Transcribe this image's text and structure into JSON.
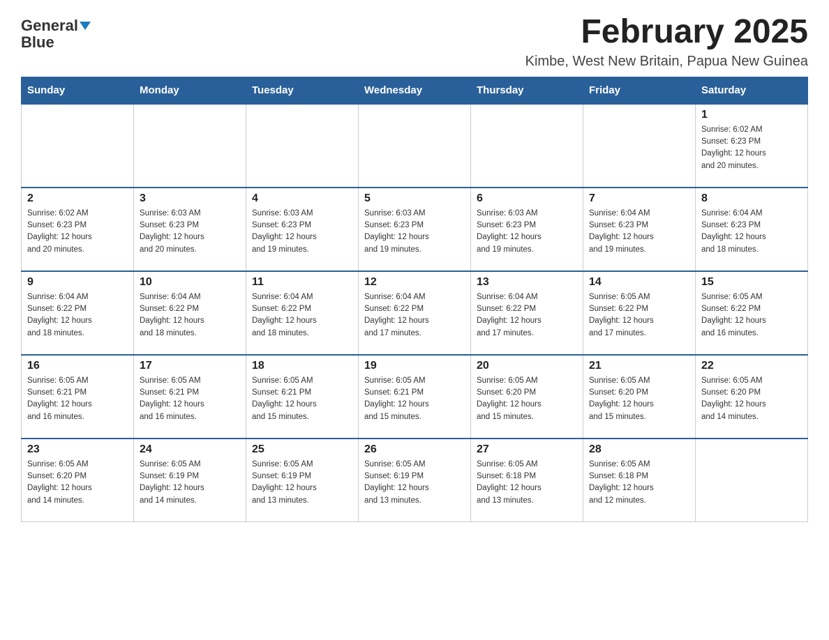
{
  "header": {
    "logo_line1": "General",
    "logo_line2": "Blue",
    "month_title": "February 2025",
    "location": "Kimbe, West New Britain, Papua New Guinea"
  },
  "weekdays": [
    "Sunday",
    "Monday",
    "Tuesday",
    "Wednesday",
    "Thursday",
    "Friday",
    "Saturday"
  ],
  "weeks": [
    [
      {
        "day": "",
        "info": ""
      },
      {
        "day": "",
        "info": ""
      },
      {
        "day": "",
        "info": ""
      },
      {
        "day": "",
        "info": ""
      },
      {
        "day": "",
        "info": ""
      },
      {
        "day": "",
        "info": ""
      },
      {
        "day": "1",
        "info": "Sunrise: 6:02 AM\nSunset: 6:23 PM\nDaylight: 12 hours\nand 20 minutes."
      }
    ],
    [
      {
        "day": "2",
        "info": "Sunrise: 6:02 AM\nSunset: 6:23 PM\nDaylight: 12 hours\nand 20 minutes."
      },
      {
        "day": "3",
        "info": "Sunrise: 6:03 AM\nSunset: 6:23 PM\nDaylight: 12 hours\nand 20 minutes."
      },
      {
        "day": "4",
        "info": "Sunrise: 6:03 AM\nSunset: 6:23 PM\nDaylight: 12 hours\nand 19 minutes."
      },
      {
        "day": "5",
        "info": "Sunrise: 6:03 AM\nSunset: 6:23 PM\nDaylight: 12 hours\nand 19 minutes."
      },
      {
        "day": "6",
        "info": "Sunrise: 6:03 AM\nSunset: 6:23 PM\nDaylight: 12 hours\nand 19 minutes."
      },
      {
        "day": "7",
        "info": "Sunrise: 6:04 AM\nSunset: 6:23 PM\nDaylight: 12 hours\nand 19 minutes."
      },
      {
        "day": "8",
        "info": "Sunrise: 6:04 AM\nSunset: 6:23 PM\nDaylight: 12 hours\nand 18 minutes."
      }
    ],
    [
      {
        "day": "9",
        "info": "Sunrise: 6:04 AM\nSunset: 6:22 PM\nDaylight: 12 hours\nand 18 minutes."
      },
      {
        "day": "10",
        "info": "Sunrise: 6:04 AM\nSunset: 6:22 PM\nDaylight: 12 hours\nand 18 minutes."
      },
      {
        "day": "11",
        "info": "Sunrise: 6:04 AM\nSunset: 6:22 PM\nDaylight: 12 hours\nand 18 minutes."
      },
      {
        "day": "12",
        "info": "Sunrise: 6:04 AM\nSunset: 6:22 PM\nDaylight: 12 hours\nand 17 minutes."
      },
      {
        "day": "13",
        "info": "Sunrise: 6:04 AM\nSunset: 6:22 PM\nDaylight: 12 hours\nand 17 minutes."
      },
      {
        "day": "14",
        "info": "Sunrise: 6:05 AM\nSunset: 6:22 PM\nDaylight: 12 hours\nand 17 minutes."
      },
      {
        "day": "15",
        "info": "Sunrise: 6:05 AM\nSunset: 6:22 PM\nDaylight: 12 hours\nand 16 minutes."
      }
    ],
    [
      {
        "day": "16",
        "info": "Sunrise: 6:05 AM\nSunset: 6:21 PM\nDaylight: 12 hours\nand 16 minutes."
      },
      {
        "day": "17",
        "info": "Sunrise: 6:05 AM\nSunset: 6:21 PM\nDaylight: 12 hours\nand 16 minutes."
      },
      {
        "day": "18",
        "info": "Sunrise: 6:05 AM\nSunset: 6:21 PM\nDaylight: 12 hours\nand 15 minutes."
      },
      {
        "day": "19",
        "info": "Sunrise: 6:05 AM\nSunset: 6:21 PM\nDaylight: 12 hours\nand 15 minutes."
      },
      {
        "day": "20",
        "info": "Sunrise: 6:05 AM\nSunset: 6:20 PM\nDaylight: 12 hours\nand 15 minutes."
      },
      {
        "day": "21",
        "info": "Sunrise: 6:05 AM\nSunset: 6:20 PM\nDaylight: 12 hours\nand 15 minutes."
      },
      {
        "day": "22",
        "info": "Sunrise: 6:05 AM\nSunset: 6:20 PM\nDaylight: 12 hours\nand 14 minutes."
      }
    ],
    [
      {
        "day": "23",
        "info": "Sunrise: 6:05 AM\nSunset: 6:20 PM\nDaylight: 12 hours\nand 14 minutes."
      },
      {
        "day": "24",
        "info": "Sunrise: 6:05 AM\nSunset: 6:19 PM\nDaylight: 12 hours\nand 14 minutes."
      },
      {
        "day": "25",
        "info": "Sunrise: 6:05 AM\nSunset: 6:19 PM\nDaylight: 12 hours\nand 13 minutes."
      },
      {
        "day": "26",
        "info": "Sunrise: 6:05 AM\nSunset: 6:19 PM\nDaylight: 12 hours\nand 13 minutes."
      },
      {
        "day": "27",
        "info": "Sunrise: 6:05 AM\nSunset: 6:18 PM\nDaylight: 12 hours\nand 13 minutes."
      },
      {
        "day": "28",
        "info": "Sunrise: 6:05 AM\nSunset: 6:18 PM\nDaylight: 12 hours\nand 12 minutes."
      },
      {
        "day": "",
        "info": ""
      }
    ]
  ]
}
